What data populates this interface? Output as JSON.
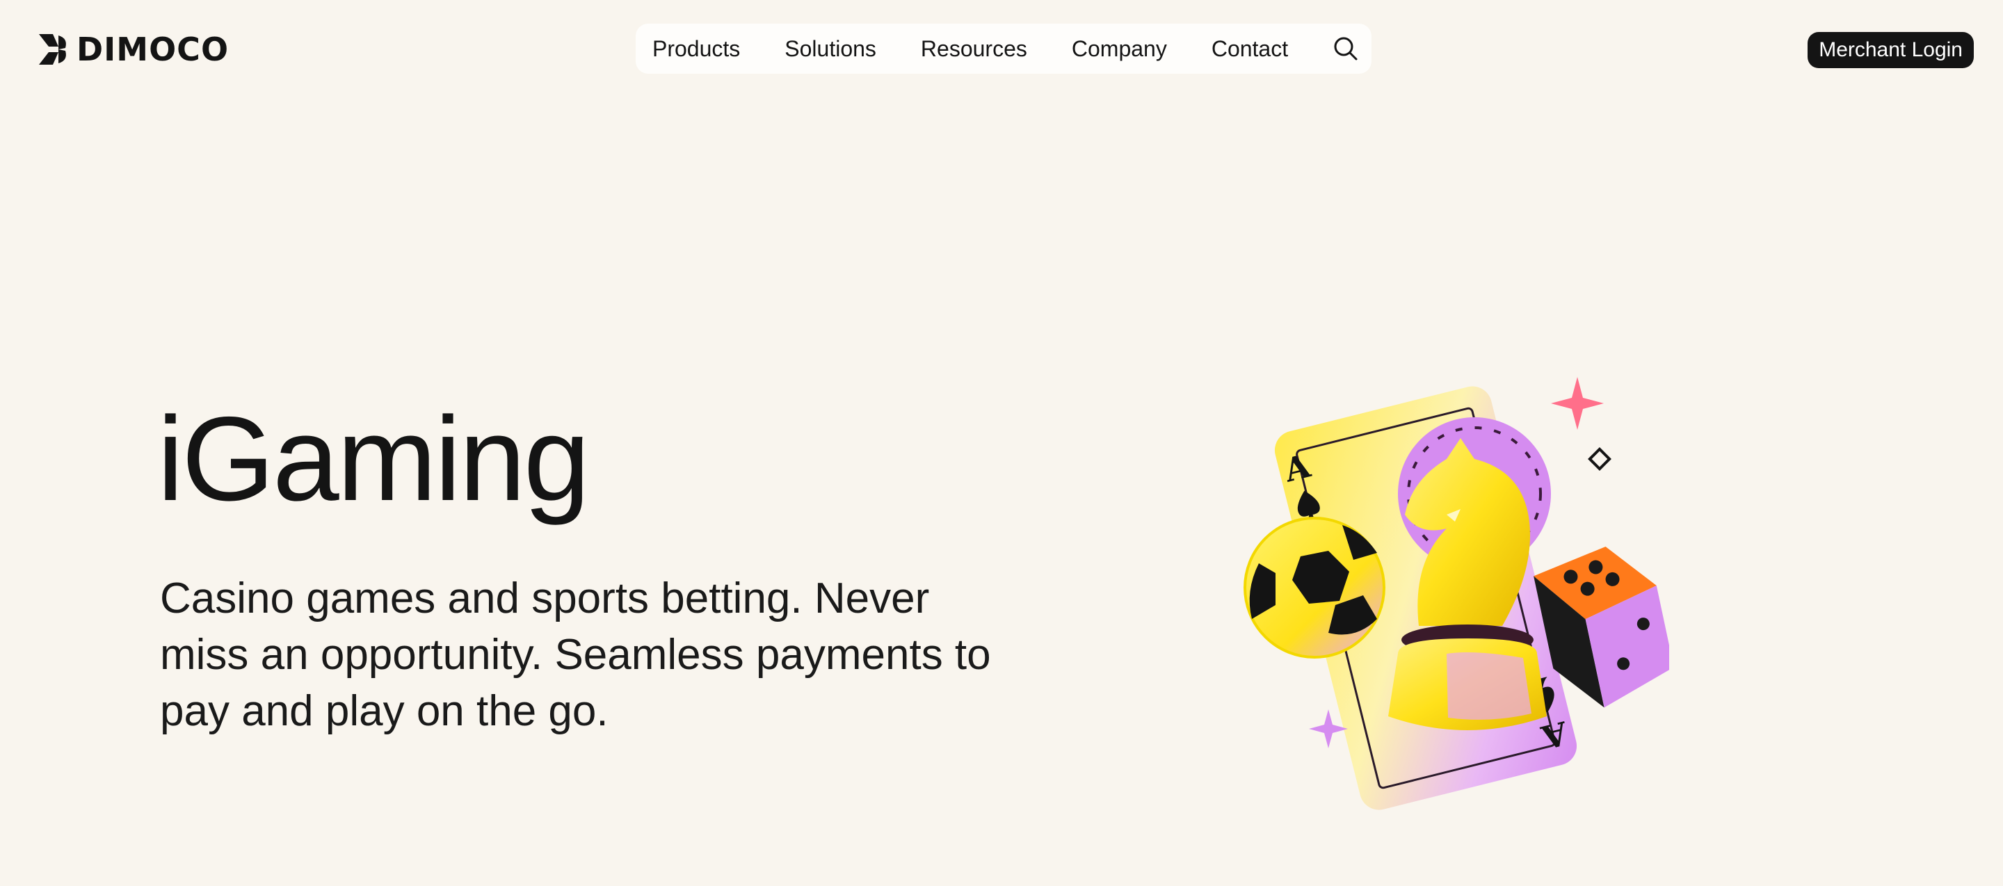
{
  "header": {
    "logo_text": "DIMOCO",
    "nav": [
      "Products",
      "Solutions",
      "Resources",
      "Company",
      "Contact"
    ],
    "login_label": "Merchant Login"
  },
  "hero": {
    "title": "iGaming",
    "description": "Casino games and sports betting. Never miss an opportunity. Seamless payments to pay and play on the go."
  },
  "colors": {
    "background": "#f9f5ee",
    "text": "#141414",
    "accent_yellow": "#ffe11a",
    "accent_purple": "#d58cf0",
    "accent_orange": "#ff7a1a"
  },
  "illustration": {
    "card_rank": "A"
  },
  "icons": [
    "dimoco-logo-icon",
    "search-icon"
  ]
}
